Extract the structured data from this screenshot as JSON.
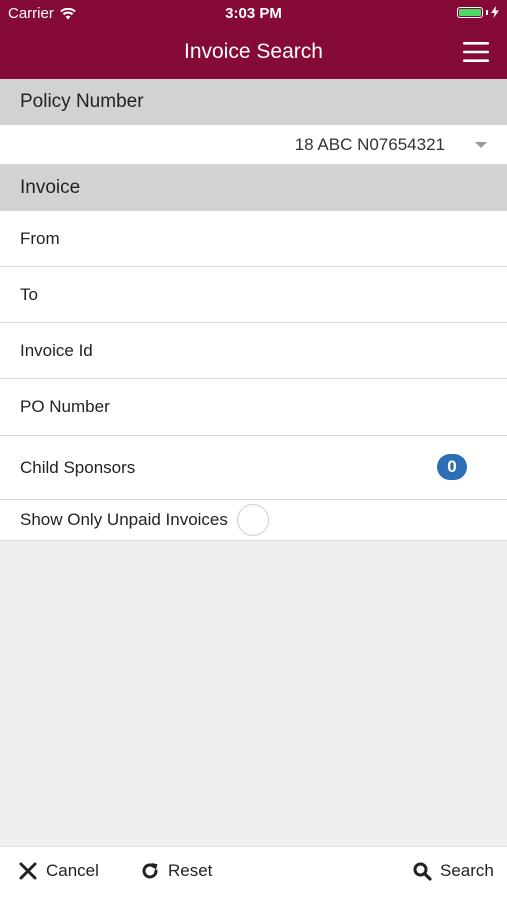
{
  "status_bar": {
    "carrier": "Carrier",
    "time": "3:03 PM"
  },
  "header": {
    "title": "Invoice Search",
    "menu_icon": "hamburger-menu-icon"
  },
  "colors": {
    "brand": "#850a38",
    "badge": "#2a6fb5",
    "section_header": "#d2d2d2",
    "background": "#efefef"
  },
  "policy": {
    "section_label": "Policy Number",
    "selected_value": "18 ABC N07654321"
  },
  "invoice": {
    "section_label": "Invoice",
    "fields": {
      "from_label": "From",
      "to_label": "To",
      "invoice_id_label": "Invoice Id",
      "po_number_label": "PO Number"
    },
    "child_sponsors": {
      "label": "Child Sponsors",
      "count": "0"
    },
    "unpaid_toggle": {
      "label": "Show Only Unpaid Invoices",
      "checked": false
    }
  },
  "toolbar": {
    "cancel_label": "Cancel",
    "reset_label": "Reset",
    "search_label": "Search"
  }
}
